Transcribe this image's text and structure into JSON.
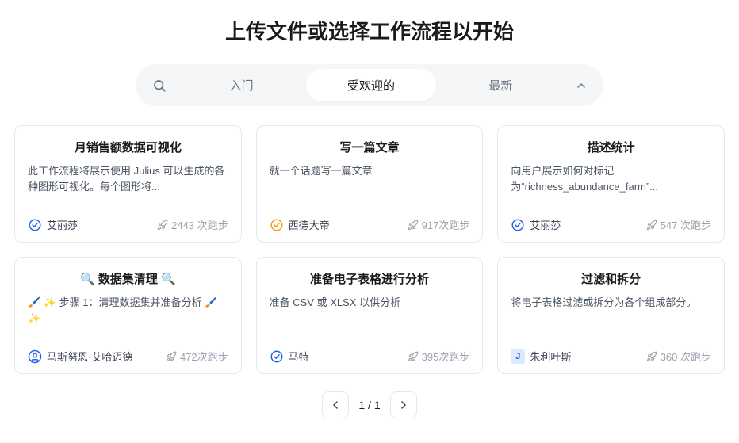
{
  "header": {
    "title": "上传文件或选择工作流程以开始"
  },
  "filter": {
    "tabs": [
      {
        "label": "入门"
      },
      {
        "label": "受欢迎的"
      },
      {
        "label": "最新"
      }
    ],
    "active_index": 1
  },
  "cards": [
    {
      "title": "月销售额数据可视化",
      "desc": "此工作流程将展示使用 Julius 可以生成的各种图形可视化。每个图形将...",
      "author": "艾丽莎",
      "author_icon": "verified-blue",
      "runs": "2443 次跑步"
    },
    {
      "title": "写一篇文章",
      "desc": "就一个话题写一篇文章",
      "author": "西德大帝",
      "author_icon": "verified-orange",
      "runs": "917次跑步"
    },
    {
      "title": "描述统计",
      "desc": "向用户展示如何对标记为“richness_abundance_farm”...",
      "author": "艾丽莎",
      "author_icon": "verified-blue",
      "runs": "547 次跑步"
    },
    {
      "title": "🔍 数据集清理 🔍",
      "desc": "🖌️ ✨ 步骤 1：清理数据集并准备分析 🖌️ ✨",
      "author": "马斯努恩·艾哈迈德",
      "author_icon": "user-circle",
      "runs": "472次跑步"
    },
    {
      "title": "准备电子表格进行分析",
      "desc": "准备 CSV 或 XLSX 以供分析",
      "author": "马特",
      "author_icon": "verified-blue",
      "runs": "395次跑步"
    },
    {
      "title": "过滤和拆分",
      "desc": "将电子表格过滤或拆分为各个组成部分。",
      "author": "朱利叶斯",
      "author_icon": "letter-J",
      "runs": "360 次跑步"
    }
  ],
  "pagination": {
    "indicator": "1 / 1"
  }
}
